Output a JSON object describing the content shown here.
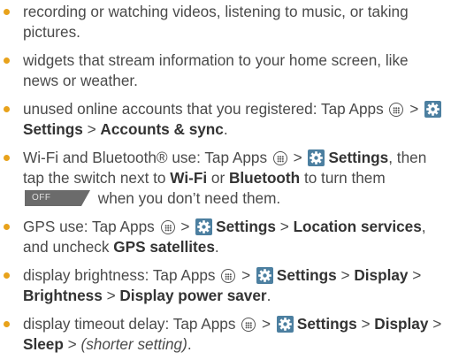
{
  "sep": ">",
  "toggle_off_label": "OFF",
  "colors": {
    "bullet": "#e8a21b",
    "text": "#4a4a4a",
    "settings_icon_bg": "#4c7fa0",
    "toggle_bg": "#6b6b6b"
  },
  "icons": {
    "apps": "apps-grid-circle-icon",
    "settings": "gear-icon"
  },
  "items": {
    "i1": {
      "text": "recording or watching videos, listening to music, or taking pictures."
    },
    "i2": {
      "text": "widgets that stream information to your home screen, like news or weather."
    },
    "i3": {
      "pre": "unused online accounts that you registered: Tap Apps",
      "settings": "Settings",
      "b1": "Accounts & sync",
      "post": "."
    },
    "i4": {
      "pre": "Wi-Fi and Bluetooth® use: Tap Apps",
      "settings": "Settings",
      "mid1": ", then tap the switch next to",
      "b1": "Wi-Fi",
      "or": "or",
      "b2": "Bluetooth",
      "mid2": "to turn them",
      "post": "when you don’t need them."
    },
    "i5": {
      "pre": "GPS use: Tap Apps",
      "settings": "Settings",
      "b1": "Location services",
      "mid": ", and uncheck",
      "b2": "GPS satellites",
      "post": "."
    },
    "i6": {
      "pre": "display brightness: Tap Apps",
      "settings": "Settings",
      "b1": "Display",
      "b2": "Brightness",
      "b3": "Display power saver",
      "post": "."
    },
    "i7": {
      "pre": "display timeout delay: Tap Apps",
      "settings": "Settings",
      "b1": "Display",
      "b2": "Sleep",
      "it1": "(shorter setting)",
      "post": "."
    }
  }
}
